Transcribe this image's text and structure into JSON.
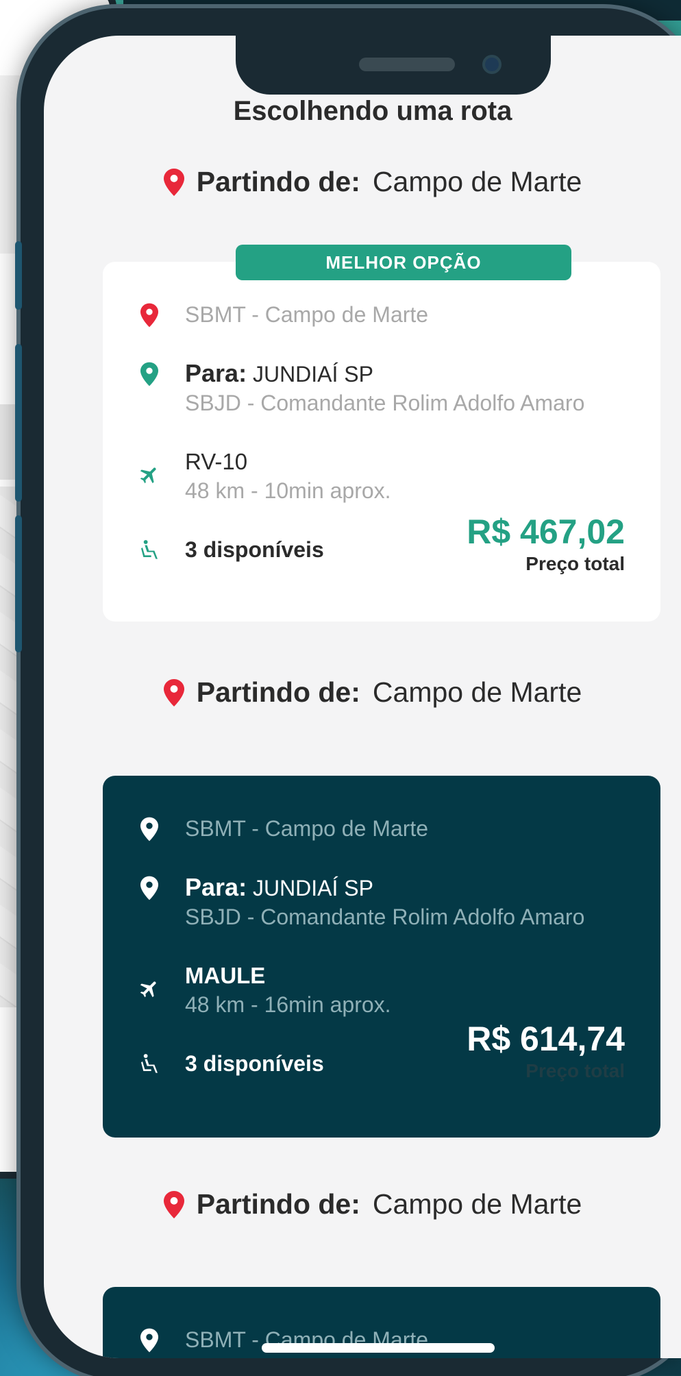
{
  "header": {
    "title": "Escolhendo uma rota"
  },
  "colors": {
    "accent": "#24a184",
    "pin_red": "#e8283a",
    "dark_card": "#043946"
  },
  "routes": [
    {
      "departure_label": "Partindo de:",
      "departure_value": "Campo de Marte",
      "badge": "MELHOR OPÇÃO",
      "origin": "SBMT - Campo de Marte",
      "dest_label": "Para:",
      "dest_city": "JUNDIAÍ SP",
      "dest_airport": "SBJD - Comandante Rolim Adolfo Amaro",
      "aircraft": "RV-10",
      "distance": "48 km - 10min aprox.",
      "seats": "3 disponíveis",
      "price": "R$ 467,02",
      "price_label": "Preço total"
    },
    {
      "departure_label": "Partindo de:",
      "departure_value": "Campo de Marte",
      "origin": "SBMT - Campo de Marte",
      "dest_label": "Para:",
      "dest_city": "JUNDIAÍ SP",
      "dest_airport": "SBJD - Comandante Rolim Adolfo Amaro",
      "aircraft": "MAULE",
      "distance": "48 km - 16min aprox.",
      "seats": "3 disponíveis",
      "price": "R$ 614,74",
      "price_label": "Preço total"
    },
    {
      "departure_label": "Partindo de:",
      "departure_value": "Campo de Marte",
      "origin": "SBMT - Campo de Marte"
    }
  ]
}
